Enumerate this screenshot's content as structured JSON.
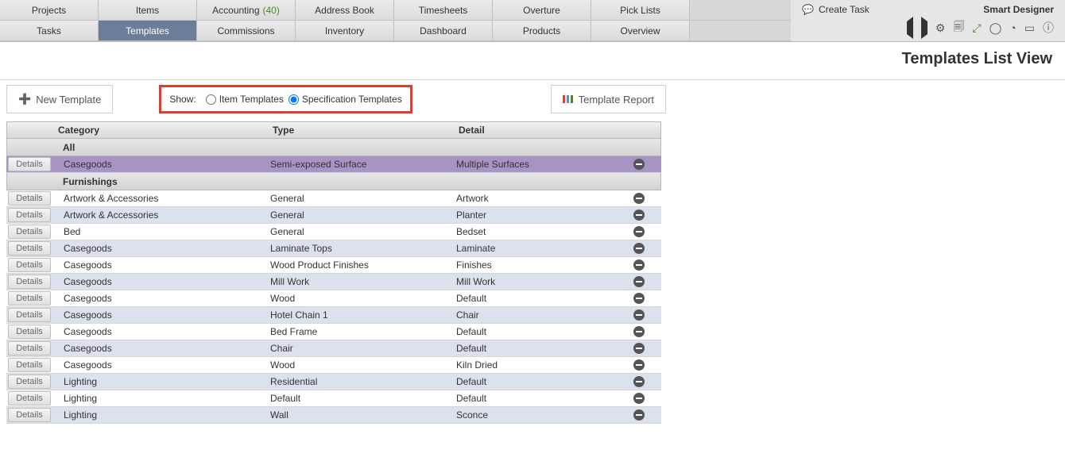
{
  "nav": {
    "row1": [
      "Projects",
      "Items",
      "Accounting",
      "Address Book",
      "Timesheets",
      "Overture",
      "Pick Lists"
    ],
    "row2": [
      "Tasks",
      "Templates",
      "Commissions",
      "Inventory",
      "Dashboard",
      "Products",
      "Overview"
    ],
    "accounting_badge": "(40)",
    "active": "Templates"
  },
  "header": {
    "create_task": "Create Task",
    "brand": "Smart Designer"
  },
  "page": {
    "title": "Templates List View"
  },
  "toolbar": {
    "new_template": "New Template",
    "show_label": "Show:",
    "radio_item": "Item Templates",
    "radio_spec": "Specification Templates",
    "selected_radio": "spec",
    "report": "Template Report"
  },
  "columns": {
    "category": "Category",
    "type": "Type",
    "detail": "Detail"
  },
  "groups": [
    {
      "name": "All",
      "rows": [
        {
          "category": "Casegoods",
          "type": "Semi-exposed Surface",
          "detail": "Multiple Surfaces",
          "selected": true
        }
      ]
    },
    {
      "name": "Furnishings",
      "rows": [
        {
          "category": "Artwork & Accessories",
          "type": "General",
          "detail": "Artwork"
        },
        {
          "category": "Artwork & Accessories",
          "type": "General",
          "detail": "Planter"
        },
        {
          "category": "Bed",
          "type": "General",
          "detail": "Bedset"
        },
        {
          "category": "Casegoods",
          "type": "Laminate Tops",
          "detail": "Laminate"
        },
        {
          "category": "Casegoods",
          "type": "Wood Product Finishes",
          "detail": "Finishes"
        },
        {
          "category": "Casegoods",
          "type": "Mill Work",
          "detail": "Mill Work"
        },
        {
          "category": "Casegoods",
          "type": "Wood",
          "detail": "Default"
        },
        {
          "category": "Casegoods",
          "type": "Hotel Chain 1",
          "detail": "Chair"
        },
        {
          "category": "Casegoods",
          "type": "Bed Frame",
          "detail": "Default"
        },
        {
          "category": "Casegoods",
          "type": "Chair",
          "detail": "Default"
        },
        {
          "category": "Casegoods",
          "type": "Wood",
          "detail": "Kiln Dried"
        },
        {
          "category": "Lighting",
          "type": "Residential",
          "detail": "Default"
        },
        {
          "category": "Lighting",
          "type": "Default",
          "detail": "Default"
        },
        {
          "category": "Lighting",
          "type": "Wall",
          "detail": "Sconce"
        }
      ]
    }
  ],
  "details_label": "Details"
}
